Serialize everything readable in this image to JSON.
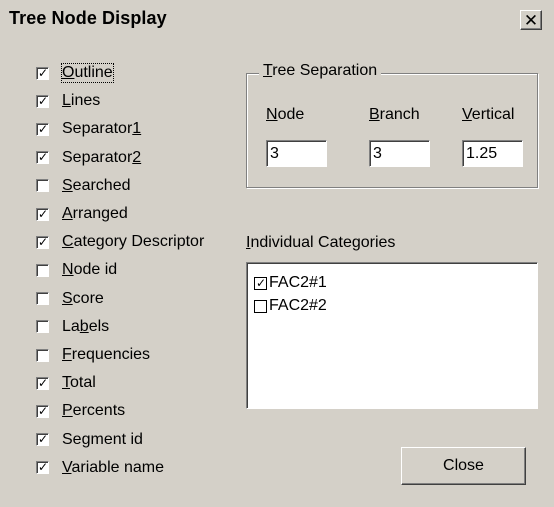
{
  "window": {
    "title": "Tree Node Display",
    "close_glyph": "✕"
  },
  "options": [
    {
      "pre": "",
      "key": "O",
      "post": "utline",
      "checked": true,
      "focused": true
    },
    {
      "pre": "",
      "key": "L",
      "post": "ines",
      "checked": true
    },
    {
      "pre": "Separator",
      "key": "1",
      "post": "",
      "checked": true
    },
    {
      "pre": "Separator",
      "key": "2",
      "post": "",
      "checked": true
    },
    {
      "pre": "",
      "key": "S",
      "post": "earched",
      "checked": false
    },
    {
      "pre": "",
      "key": "A",
      "post": "rranged",
      "checked": true
    },
    {
      "pre": "",
      "key": "C",
      "post": "ategory Descriptor",
      "checked": true
    },
    {
      "pre": "",
      "key": "N",
      "post": "ode id",
      "checked": false
    },
    {
      "pre": "",
      "key": "S",
      "post": "core",
      "checked": false
    },
    {
      "pre": "La",
      "key": "b",
      "post": "els",
      "checked": false
    },
    {
      "pre": "",
      "key": "F",
      "post": "requencies",
      "checked": false
    },
    {
      "pre": "",
      "key": "T",
      "post": "otal",
      "checked": true
    },
    {
      "pre": "",
      "key": "P",
      "post": "ercents",
      "checked": true
    },
    {
      "pre": "Se",
      "key": "g",
      "post": "ment id",
      "checked": true
    },
    {
      "pre": "",
      "key": "V",
      "post": "ariable name",
      "checked": true
    }
  ],
  "tree_separation": {
    "group_label_key": "T",
    "group_label_rest": "ree Separation",
    "node_label_key": "N",
    "node_label_rest": "ode",
    "node_value": "3",
    "branch_label_key": "B",
    "branch_label_rest": "ranch",
    "branch_value": "3",
    "vertical_label_key": "V",
    "vertical_label_rest": "ertical",
    "vertical_value": "1.25"
  },
  "categories": {
    "label_key": "I",
    "label_rest": "ndividual Categories",
    "items": [
      {
        "label": "FAC2#1",
        "checked": true
      },
      {
        "label": "FAC2#2",
        "checked": false
      }
    ]
  },
  "buttons": {
    "close_label": "Close"
  },
  "check_glyph": "✓"
}
